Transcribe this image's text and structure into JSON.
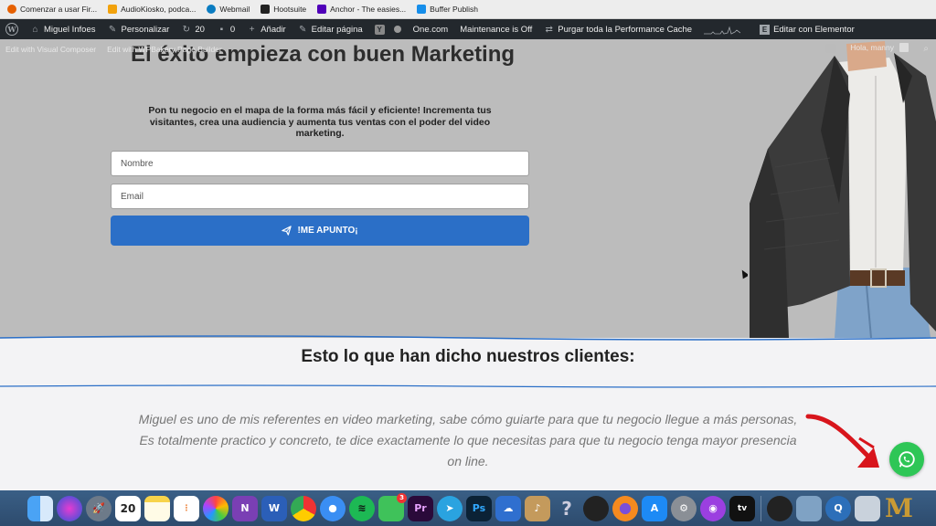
{
  "bookmarks": [
    {
      "label": "Comenzar a usar Fir...",
      "color": "#e66000"
    },
    {
      "label": "AudioKiosko, podca...",
      "color": "#f2a20c"
    },
    {
      "label": "Webmail",
      "color": "#0a7cc1"
    },
    {
      "label": "Hootsuite",
      "color": "#222222"
    },
    {
      "label": "Anchor - The easies...",
      "color": "#5000b9"
    },
    {
      "label": "Buffer Publish",
      "color": "#168eea"
    }
  ],
  "adminbar": {
    "site": "Miguel Infoes",
    "customize": "Personalizar",
    "updates": "20",
    "comments": "0",
    "add_new": "Añadir",
    "edit_page": "Editar página",
    "onecom": "One.com",
    "maintenance": "Maintenance is Off",
    "purge": "Purgar toda la Performance Cache",
    "elementor": "Editar con Elementor"
  },
  "subbar": {
    "visual_composer": "Edit with Visual Composer",
    "wpbakery": "Edit with WPBakery Page Builder",
    "greeting": "Hola, manny"
  },
  "hero": {
    "title": "El éxito empieza con buen Marketing",
    "subtitle": "Pon tu negocio en el mapa de la forma más fácil y eficiente! Incrementa tus visitantes, crea una audiencia y aumenta tus ventas con el poder del video marketing.",
    "name_placeholder": "Nombre",
    "email_placeholder": "Email",
    "submit_label": "!ME APUNTO¡",
    "bg_color": "#bcbcbc",
    "button_color": "#2b6fc7"
  },
  "testimonials": {
    "heading": "Esto lo que han dicho nuestros clientes:",
    "quote": "Miguel es uno de mis referentes en video marketing, sabe cómo guiarte para que tu negocio llegue a más personas, Es totalmente practico y concreto, te dice exactamente lo que necesitas para que tu negocio tenga mayor presencia on line."
  },
  "whatsapp": {
    "icon": "whatsapp-icon",
    "color": "#2ec656"
  },
  "dock": {
    "calendar_day": "20",
    "premiere_label": "Pr",
    "photoshop_label": "Ps",
    "tv_label": "tv",
    "word_label": "W",
    "onenote_label": "N",
    "facetime_badge": "3"
  }
}
